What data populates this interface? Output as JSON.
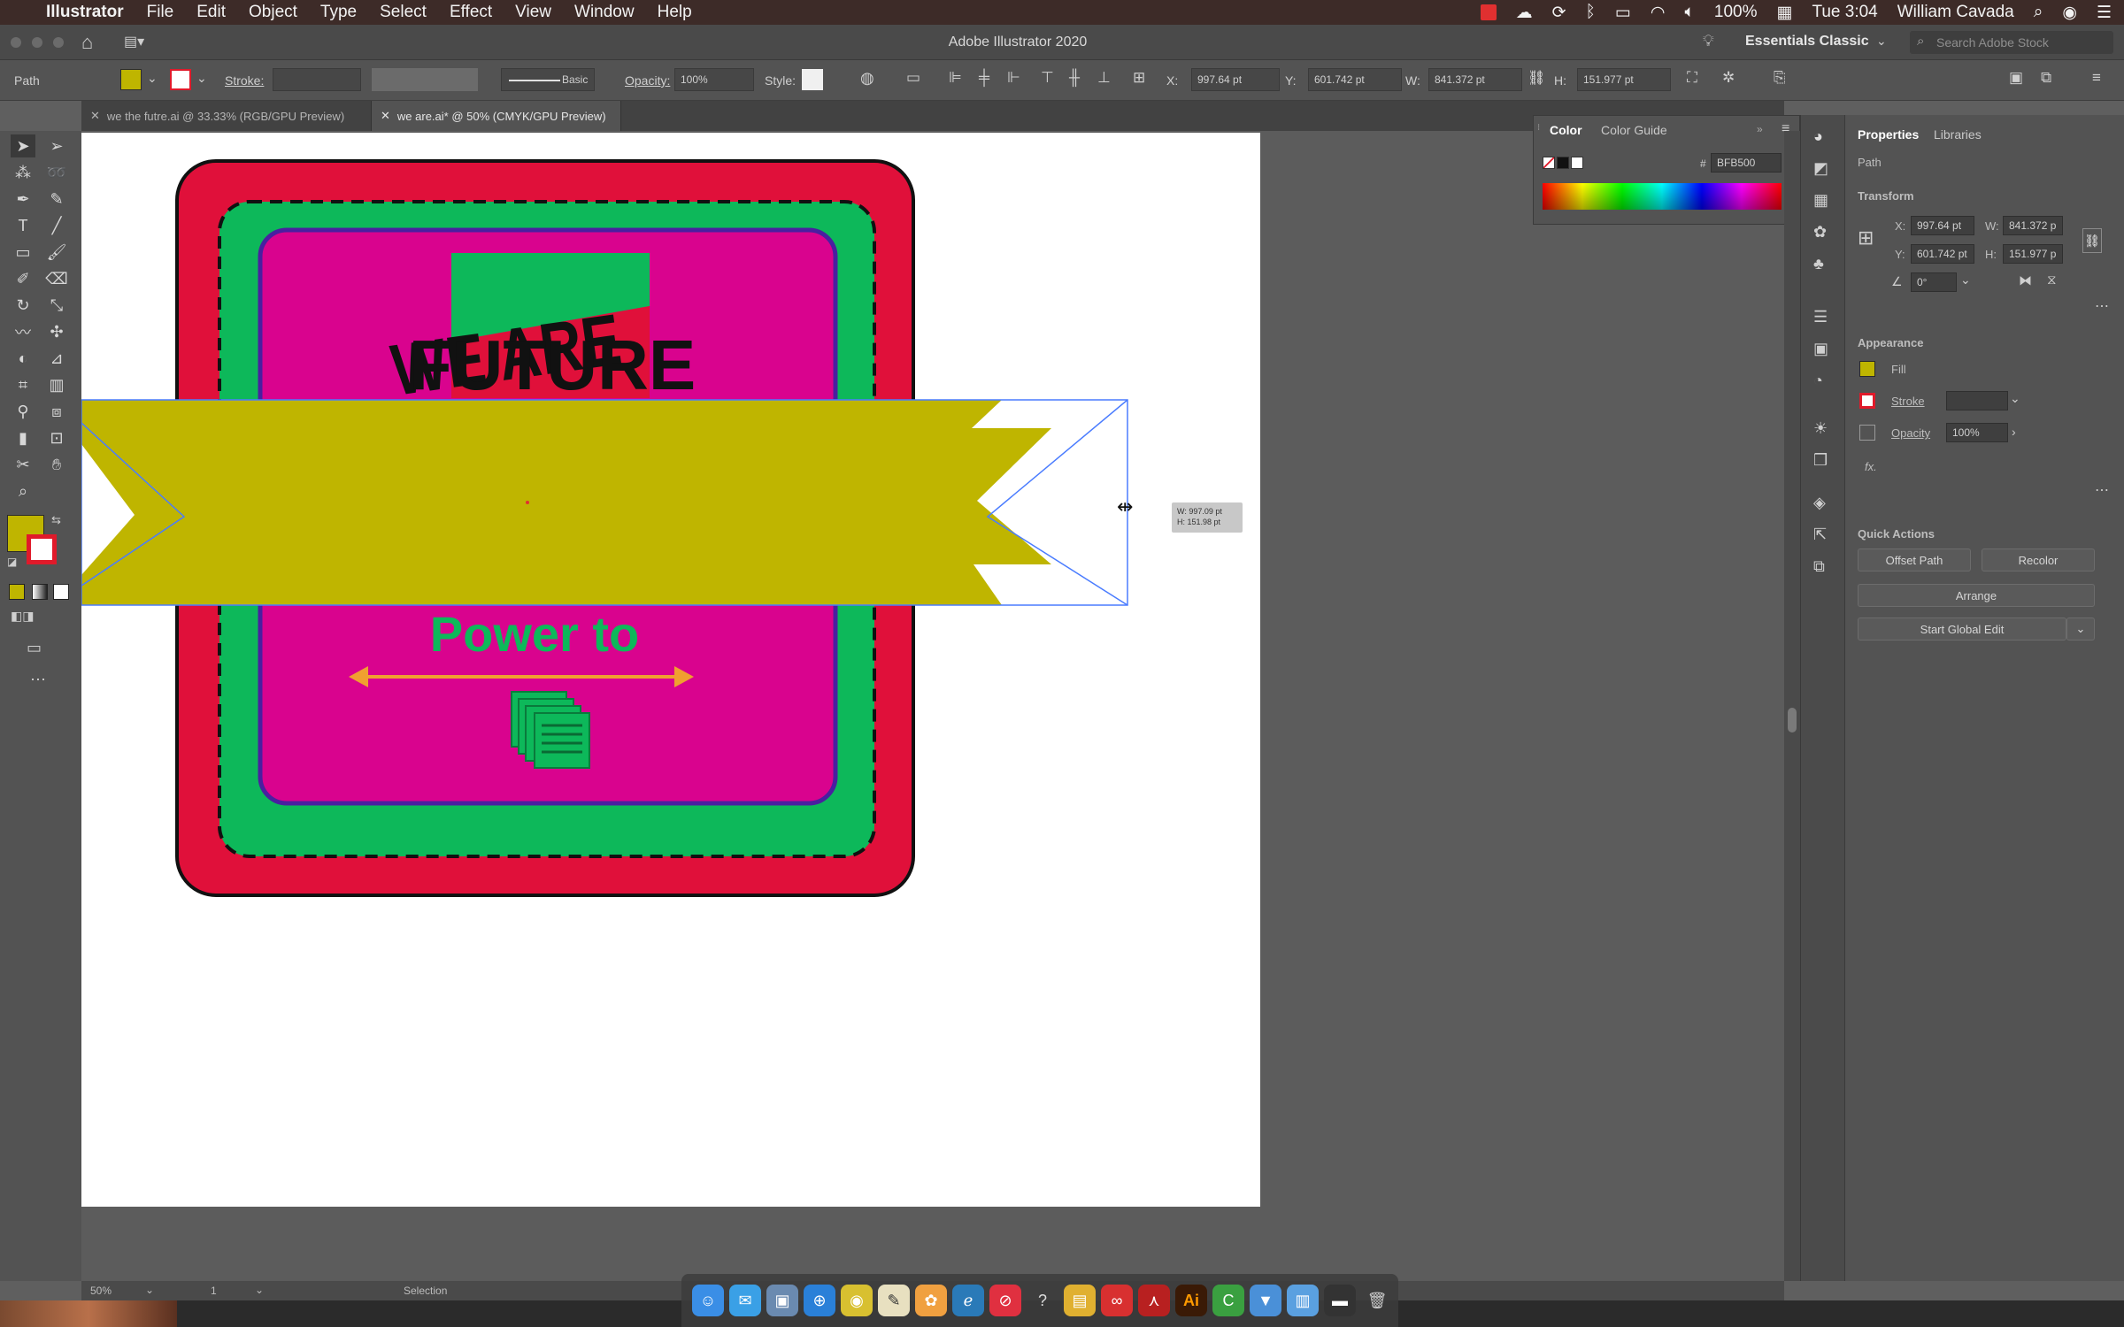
{
  "menubar": {
    "apple": "",
    "app": "Illustrator",
    "items": [
      "File",
      "Edit",
      "Object",
      "Type",
      "Select",
      "Effect",
      "View",
      "Window",
      "Help"
    ],
    "battery": "100%",
    "clock": "Tue 3:04",
    "user": "William Cavada"
  },
  "titlebar": {
    "title": "Adobe Illustrator 2020",
    "workspace": "Essentials Classic",
    "search_placeholder": "Search Adobe Stock"
  },
  "controlbar": {
    "selection_type": "Path",
    "stroke_label": "Stroke:",
    "stroke_style": "Basic",
    "opacity_label": "Opacity:",
    "opacity_value": "100%",
    "style_label": "Style:",
    "x_label": "X:",
    "x_value": "997.64 pt",
    "y_label": "Y:",
    "y_value": "601.742 pt",
    "w_label": "W:",
    "w_value": "841.372 pt",
    "h_label": "H:",
    "h_value": "151.977 pt"
  },
  "tabs": [
    {
      "label": "we the futre.ai @ 33.33% (RGB/GPU Preview)"
    },
    {
      "label": "we are.ai* @ 50% (CMYK/GPU Preview)"
    }
  ],
  "artwork": {
    "headline_line1": "WE ARE",
    "headline_line2": "FUTURE",
    "tagline": "Power to"
  },
  "tooltip": {
    "line1": "W: 997.09 pt",
    "line2": "H: 151.98 pt"
  },
  "color_panel": {
    "tab_color": "Color",
    "tab_guide": "Color Guide",
    "hex_prefix": "#",
    "hex_value": "BFB500"
  },
  "properties": {
    "tab_properties": "Properties",
    "tab_libraries": "Libraries",
    "object_type": "Path",
    "transform_title": "Transform",
    "x_label": "X:",
    "x_value": "997.64 pt",
    "y_label": "Y:",
    "y_value": "601.742 pt",
    "w_label": "W:",
    "w_value": "841.372 p",
    "h_label": "H:",
    "h_value": "151.977 p",
    "angle_value": "0°",
    "appearance_title": "Appearance",
    "fill_label": "Fill",
    "stroke_label": "Stroke",
    "opacity_label": "Opacity",
    "opacity_value": "100%",
    "fx_label": "fx.",
    "quick_actions_title": "Quick Actions",
    "offset_path": "Offset Path",
    "recolor": "Recolor",
    "arrange": "Arrange",
    "start_global_edit": "Start Global Edit"
  },
  "statusbar": {
    "zoom": "50%",
    "artboard": "1",
    "tool": "Selection"
  },
  "colors": {
    "fill": "#BFB500",
    "red": "#E0103A",
    "green": "#0DB85A",
    "magenta": "#D9038E",
    "orange": "#F0A030"
  }
}
